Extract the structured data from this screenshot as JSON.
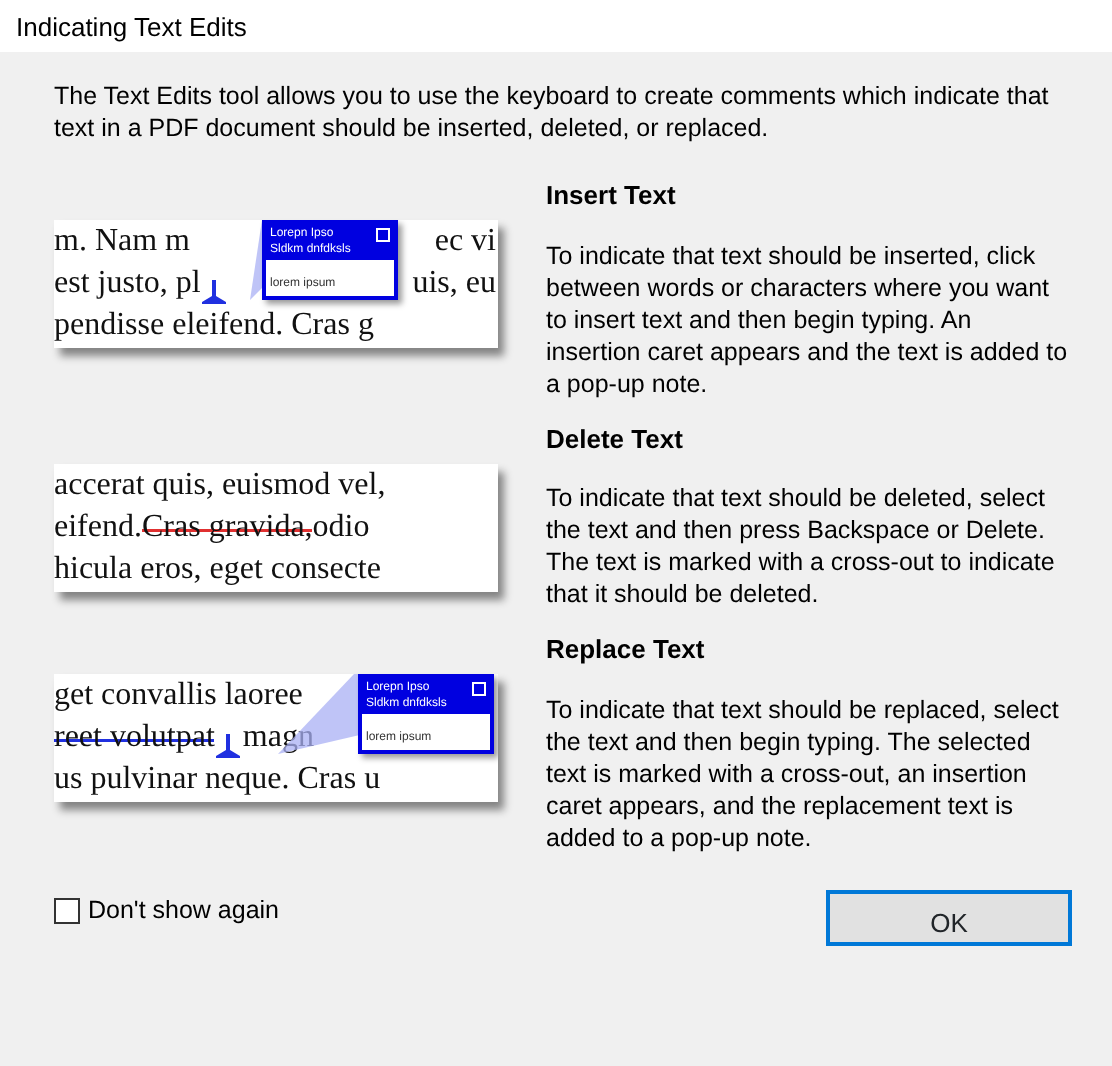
{
  "window": {
    "title": "Indicating Text Edits"
  },
  "intro": "The Text Edits tool allows you to use the keyboard to create comments which indicate that text in a PDF document should be inserted, deleted, or replaced.",
  "sections": [
    {
      "heading": "Insert Text",
      "body": "To indicate that text should be inserted, click between words or characters where you want to insert text and then begin typing. An insertion caret appears and the text is added to a pop-up note.",
      "illustration": {
        "kind": "insert",
        "lines": [
          [
            {
              "text": "m. Nam m"
            },
            {
              "text": "ec vi",
              "kind": "after"
            }
          ],
          [
            {
              "text": "est justo, pl"
            },
            {
              "kind": "caret"
            },
            {
              "text": "uis, eu",
              "kind": "after"
            }
          ],
          [
            {
              "text": "pendisse eleifend. Cras g"
            }
          ]
        ],
        "note": {
          "title": "Lorepn Ipso",
          "subtitle": "Sldkm dnfdksls",
          "body": "lorem ipsum"
        }
      }
    },
    {
      "heading": "Delete Text",
      "body": "To indicate that text should be deleted, select the text and then press Backspace or Delete.  The text is marked with a cross-out to indicate that it should be deleted.",
      "illustration": {
        "kind": "delete",
        "lines": [
          [
            {
              "text": "accerat quis, euismod vel,"
            }
          ],
          [
            {
              "text": "eifend. "
            },
            {
              "text": "Cras gravida,",
              "kind": "struck-red"
            },
            {
              "text": " odio"
            }
          ],
          [
            {
              "text": "hicula eros, eget consecte"
            }
          ]
        ]
      }
    },
    {
      "heading": "Replace Text",
      "body": "To indicate that text should be replaced, select the text and then begin typing.  The selected text is marked with a cross-out, an insertion caret appears, and the replacement text is added to a pop-up note.",
      "illustration": {
        "kind": "replace",
        "lines": [
          [
            {
              "text": "get convallis laoree"
            }
          ],
          [
            {
              "text": "reet volutpat",
              "kind": "struck-blue"
            },
            {
              "kind": "caret"
            },
            {
              "text": " magn"
            }
          ],
          [
            {
              "text": "us pulvinar neque. Cras u"
            }
          ]
        ],
        "note": {
          "title": "Lorepn Ipso",
          "subtitle": "Sldkm dnfdksls",
          "body": "lorem ipsum"
        }
      }
    }
  ],
  "dont_show_again": {
    "label": "Don't show again",
    "checked": false
  },
  "buttons": [
    {
      "label": "OK"
    }
  ]
}
